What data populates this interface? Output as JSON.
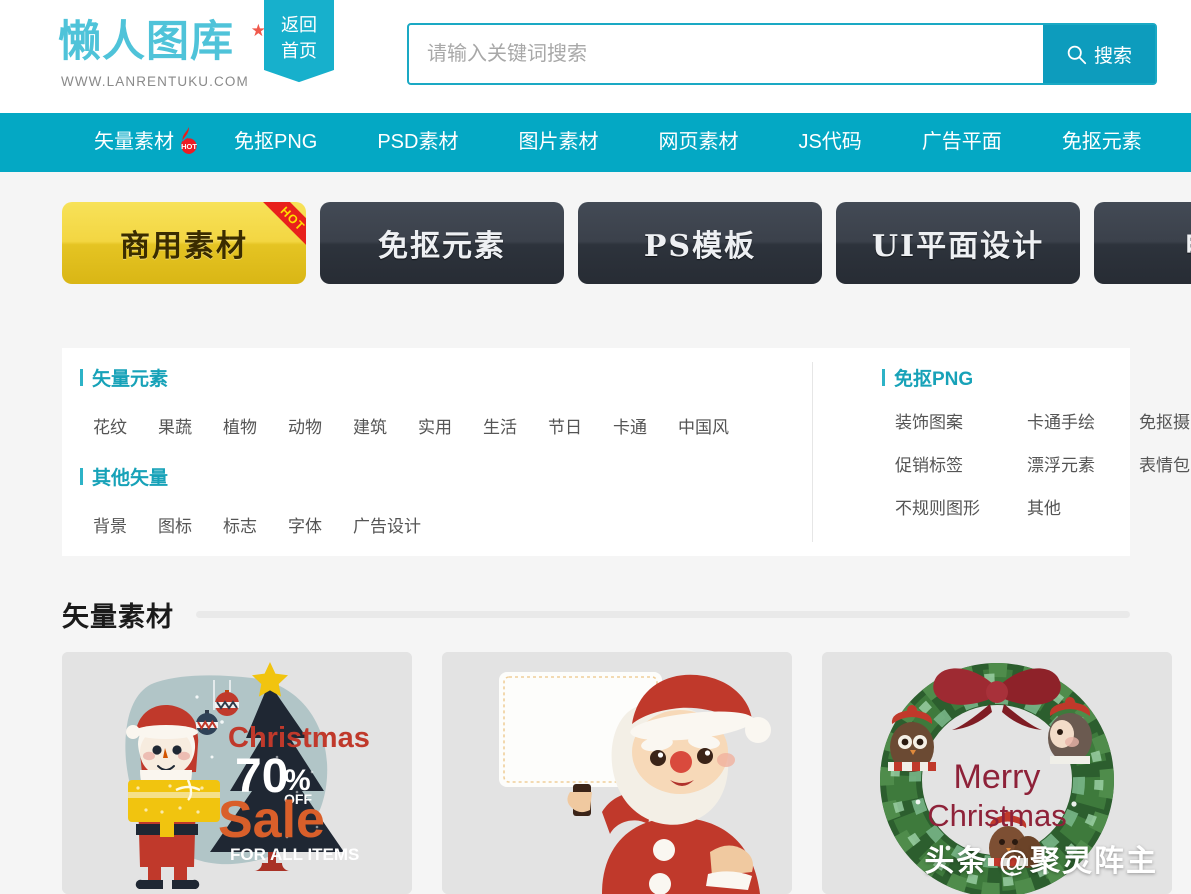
{
  "header": {
    "logo_text": "懒人图库",
    "logo_url": "WWW.LANRENTUKU.COM",
    "logo_star_icon": "star-icon",
    "ribbon_line1": "返回",
    "ribbon_line2": "首页",
    "search": {
      "placeholder": "请输入关键词搜索",
      "value": "",
      "button_label": "搜索",
      "button_icon": "search-icon"
    }
  },
  "nav": {
    "items": [
      {
        "label": "矢量素材",
        "badge": "HOT",
        "badge_icon": "flame-hot-icon"
      },
      {
        "label": "免抠PNG"
      },
      {
        "label": "PSD素材"
      },
      {
        "label": "图片素材"
      },
      {
        "label": "网页素材"
      },
      {
        "label": "JS代码"
      },
      {
        "label": "广告平面"
      },
      {
        "label": "免抠元素"
      }
    ]
  },
  "tabs": [
    {
      "label": "商用素材",
      "active": true,
      "corner_badge": "HOT"
    },
    {
      "label": "免抠元素",
      "active": false
    },
    {
      "label": "PS模板",
      "active": false
    },
    {
      "label": "UI平面设计",
      "active": false
    },
    {
      "label": "电商",
      "active": false
    }
  ],
  "panel": {
    "left": {
      "group1_title": "矢量元素",
      "group1_links": [
        "花纹",
        "果蔬",
        "植物",
        "动物",
        "建筑",
        "实用",
        "生活",
        "节日",
        "卡通",
        "中国风"
      ],
      "group2_title": "其他矢量",
      "group2_links": [
        "背景",
        "图标",
        "标志",
        "字体",
        "广告设计"
      ]
    },
    "right": {
      "title": "免抠PNG",
      "links": [
        "装饰图案",
        "卡通手绘",
        "免抠摄影",
        "促销标签",
        "漂浮元素",
        "表情包",
        "不规则图形",
        "其他"
      ]
    }
  },
  "section": {
    "title": "矢量素材"
  },
  "cards": [
    {
      "name": "christmas-sale-santa-thumbnail",
      "texts": {
        "l1": "Christmas",
        "l2": "70",
        "l3": "%",
        "l4": "OFF",
        "l5": "Sale",
        "l6": "FOR ALL ITEMS"
      }
    },
    {
      "name": "santa-blank-sign-thumbnail",
      "texts": {}
    },
    {
      "name": "merry-christmas-wreath-thumbnail",
      "texts": {
        "l1": "Merry",
        "l2": "Christmas"
      }
    }
  ],
  "watermark": "头条 @聚灵阵主",
  "colors": {
    "brand_cyan": "#04a8c4",
    "logo_cyan": "#4fc3d9",
    "search_btn": "#0d9cbd",
    "ribbon": "#17b0cc",
    "tab_gold": "#f3d642",
    "tab_dark": "#343a44",
    "hot_red": "#e8201c",
    "page_bg": "#f5f5f5",
    "group_title": "#17a2b8"
  }
}
